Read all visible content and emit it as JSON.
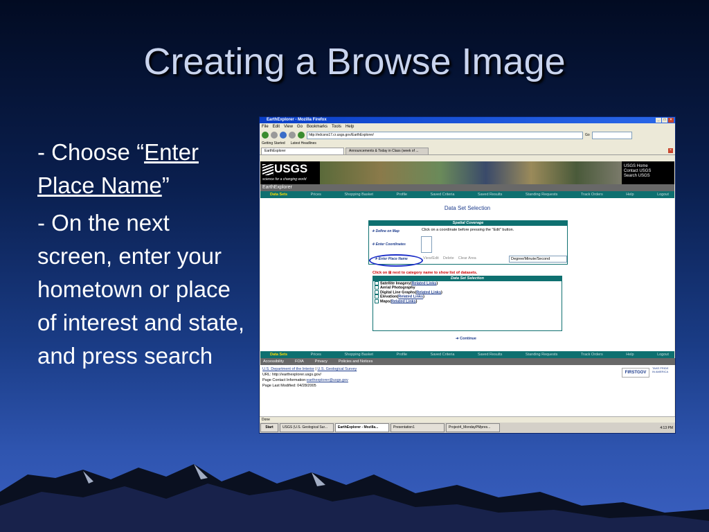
{
  "slide": {
    "title": "Creating a Browse Image",
    "bullet1_prefix": "- Choose “",
    "bullet1_link": "Enter Place Name",
    "bullet1_suffix": "”",
    "bullet2": "- On the next screen, enter your hometown or place of interest and state, and press search"
  },
  "browser": {
    "window_title": "EarthExplorer - Mozilla Firefox",
    "menu": [
      "File",
      "Edit",
      "View",
      "Go",
      "Bookmarks",
      "Tools",
      "Help"
    ],
    "address": "http://edcsns17.cr.usgs.gov/EarthExplorer/",
    "go_label": "Go",
    "bookmarks": [
      "Getting Started",
      "Latest Headlines"
    ],
    "tabs": [
      "EarthExplorer",
      "Announcements & Today in Class (week of ..."
    ],
    "status": "Done"
  },
  "site": {
    "logo_text": "USGS",
    "logo_tagline": "science for a changing world",
    "top_links": [
      "USGS Home",
      "Contact USGS",
      "Search USGS"
    ],
    "app_name": "EarthExplorer",
    "nav": [
      "Data Sets",
      "Prices",
      "Shopping Basket",
      "Profile",
      "Saved Criteria",
      "Saved Results",
      "Standing Requests",
      "Track Orders",
      "Help",
      "Logout"
    ],
    "page_heading": "Data Set Selection",
    "spatial_heading": "Spatial Coverage",
    "define_on_map": "Define on Map",
    "enter_coordinates": "Enter Coordinates",
    "enter_place_name": "Enter Place Name",
    "help_text": "Click on a coordinate before pressing the \"Edit\" button.",
    "view_edit": "View/Edit",
    "delete": "Delete",
    "clear_area": "Clear Area",
    "coord_format": "Degree/Minute/Second",
    "click_on_text": "Click on ⊞ next to category name to show list of datasets.",
    "dataset_heading": "Data Set Selection",
    "datasets": [
      {
        "name": "Satellite Imagery",
        "link": "Related Links"
      },
      {
        "name": "Aerial Photography",
        "link": ""
      },
      {
        "name": "Digital Line Graphs",
        "link": "Related Links"
      },
      {
        "name": "Elevation",
        "link": "Related Links"
      },
      {
        "name": "Maps",
        "link": "Related Links"
      }
    ],
    "continue_label": "Continue",
    "footer_links": [
      "Accessibility",
      "FOIA",
      "Privacy",
      "Policies and Notices"
    ],
    "footer_dept": "U.S. Department of the Interior",
    "footer_sep": " | ",
    "footer_survey": "U.S. Geological Survey",
    "footer_url": "URL: http://earthexplorer.usgs.gov/",
    "footer_contact_label": "Page Contact Information:",
    "footer_contact_email": "earthexplorer@usgs.gov",
    "footer_modified": "Page Last Modified: 04/28/2005",
    "firstgov": "FIRSTGOV",
    "takepride": "TAKE PRIDE IN AMERICA"
  },
  "taskbar": {
    "start": "Start",
    "items": [
      "USGS (U.S. Geological Sur...",
      "EarthExplorer - Mozilla...",
      "Presentation1",
      "Project4_MondayPMpres..."
    ],
    "clock": "4:13 PM"
  },
  "colors": {
    "accent": "#0e7070",
    "link": "#1c3b8c",
    "highlight": "#1c2ec8"
  }
}
